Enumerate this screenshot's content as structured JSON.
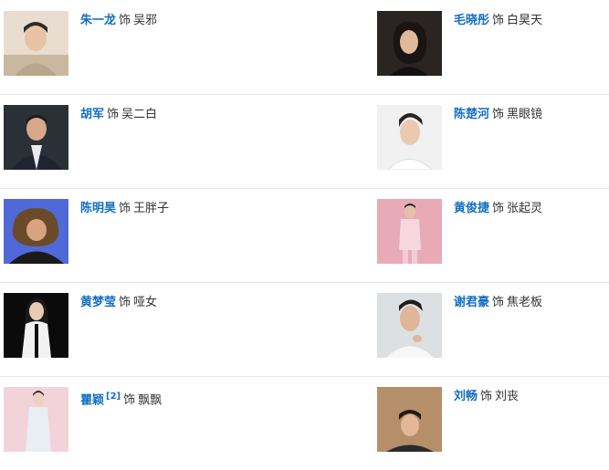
{
  "cast": [
    {
      "actor": "朱一龙",
      "sep": "饰",
      "role": "吴邪",
      "ref": ""
    },
    {
      "actor": "毛晓彤",
      "sep": "饰",
      "role": "白昊天",
      "ref": ""
    },
    {
      "actor": "胡军",
      "sep": "饰",
      "role": "吴二白",
      "ref": ""
    },
    {
      "actor": "陈楚河",
      "sep": "饰",
      "role": "黑眼镜",
      "ref": ""
    },
    {
      "actor": "陈明昊",
      "sep": "饰",
      "role": "王胖子",
      "ref": ""
    },
    {
      "actor": "黄俊捷",
      "sep": "饰",
      "role": "张起灵",
      "ref": ""
    },
    {
      "actor": "黄梦莹",
      "sep": "饰",
      "role": "哑女",
      "ref": ""
    },
    {
      "actor": "谢君豪",
      "sep": "饰",
      "role": "焦老板",
      "ref": ""
    },
    {
      "actor": "瞿颖",
      "sep": "饰",
      "role": "飘飘",
      "ref": "[2]"
    },
    {
      "actor": "刘畅",
      "sep": "饰",
      "role": "刘丧",
      "ref": ""
    }
  ],
  "colors": {
    "link": "#136ec2",
    "text": "#333333",
    "divider": "#e8e8e8"
  }
}
